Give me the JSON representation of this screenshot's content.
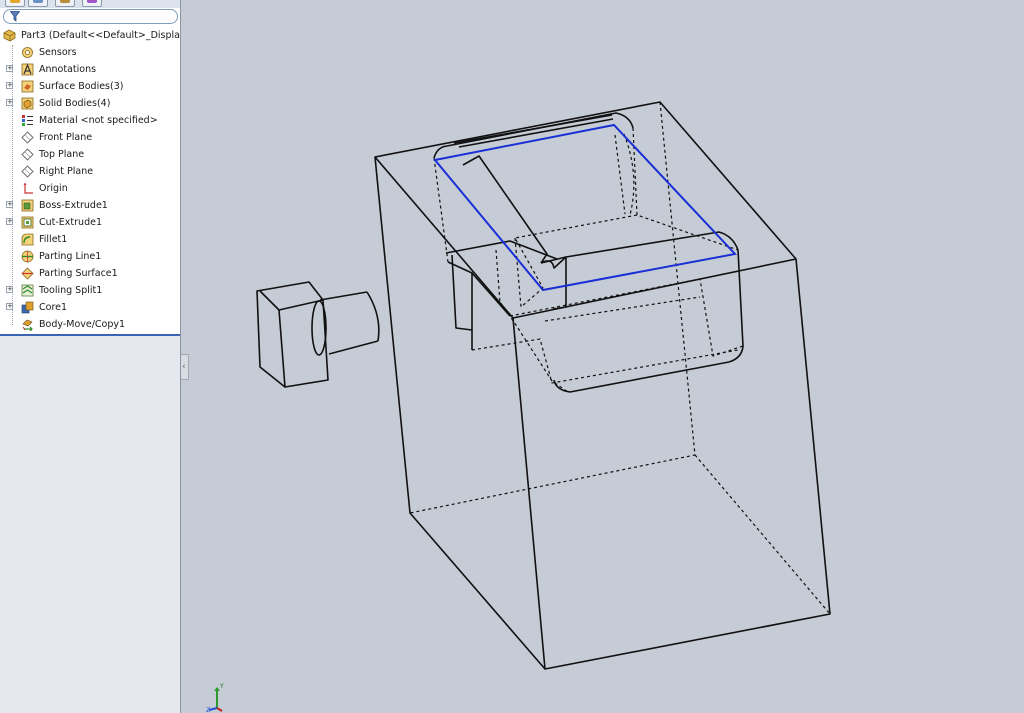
{
  "tree": {
    "root": "Part3  (Default<<Default>_Display",
    "items": [
      {
        "label": "Sensors",
        "icon": "sensor-icon",
        "expandable": false
      },
      {
        "label": "Annotations",
        "icon": "annotations-icon",
        "expandable": true
      },
      {
        "label": "Surface Bodies(3)",
        "icon": "surface-bodies-icon",
        "expandable": true
      },
      {
        "label": "Solid Bodies(4)",
        "icon": "solid-bodies-icon",
        "expandable": true
      },
      {
        "label": "Material <not specified>",
        "icon": "material-icon",
        "expandable": false
      },
      {
        "label": "Front Plane",
        "icon": "plane-icon",
        "expandable": false
      },
      {
        "label": "Top Plane",
        "icon": "plane-icon",
        "expandable": false
      },
      {
        "label": "Right Plane",
        "icon": "plane-icon",
        "expandable": false
      },
      {
        "label": "Origin",
        "icon": "origin-icon",
        "expandable": false
      },
      {
        "label": "Boss-Extrude1",
        "icon": "boss-extrude-icon",
        "expandable": true
      },
      {
        "label": "Cut-Extrude1",
        "icon": "cut-extrude-icon",
        "expandable": true
      },
      {
        "label": "Fillet1",
        "icon": "fillet-icon",
        "expandable": false
      },
      {
        "label": "Parting Line1",
        "icon": "parting-line-icon",
        "expandable": false
      },
      {
        "label": "Parting Surface1",
        "icon": "parting-surface-icon",
        "expandable": false
      },
      {
        "label": "Tooling Split1",
        "icon": "tooling-split-icon",
        "expandable": true
      },
      {
        "label": "Core1",
        "icon": "core-icon",
        "expandable": true
      },
      {
        "label": "Body-Move/Copy1",
        "icon": "body-move-copy-icon",
        "expandable": false
      }
    ]
  },
  "colors": {
    "viewport_bg": "#c6ccd6",
    "selected_edge": "#1a2fd6",
    "model_edge": "#111111",
    "tree_bg": "#ffffff",
    "tree_bottom_bg": "#e5e9ef"
  },
  "triad": {
    "x_label": "X",
    "y_label": "Y",
    "z_label": "Z"
  }
}
